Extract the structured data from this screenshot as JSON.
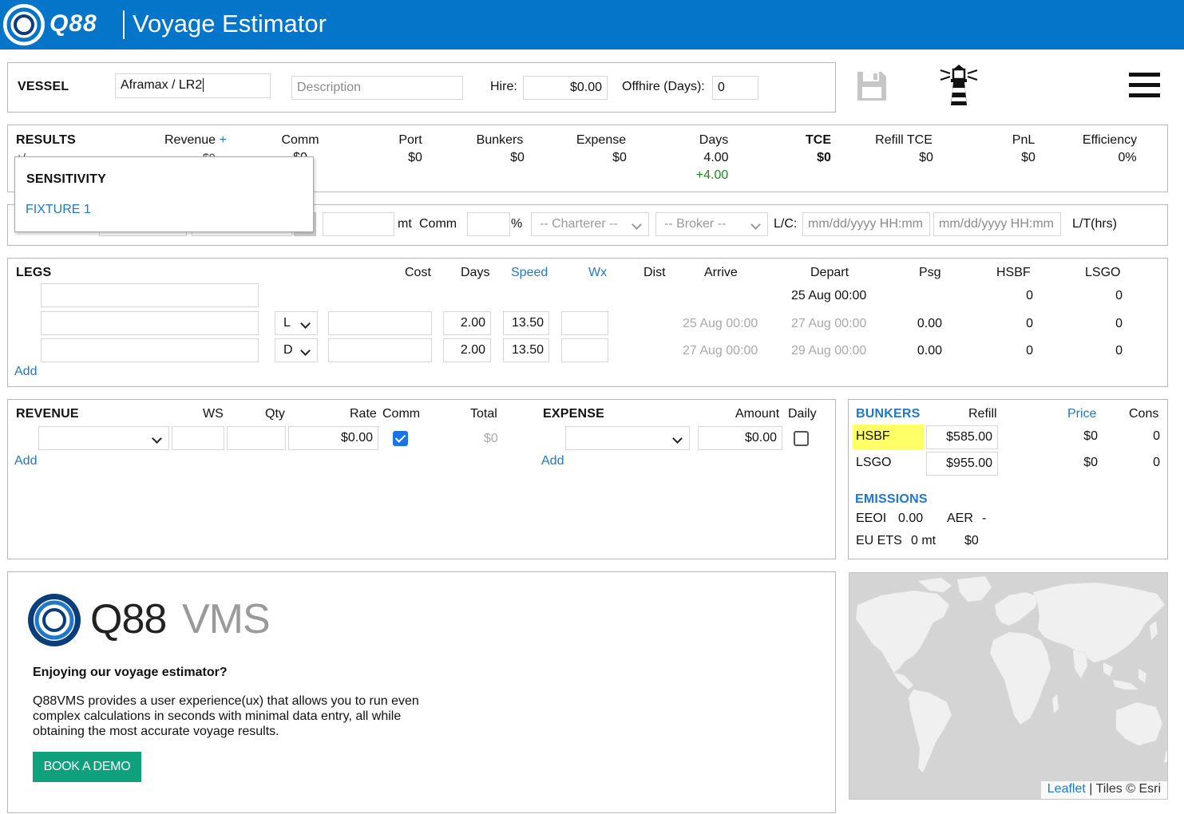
{
  "app": {
    "brand": "Q88",
    "title": "Voyage Estimator"
  },
  "colors": {
    "topbar": "#0575c9",
    "link": "#1f78c8",
    "positive": "#1a8a1a",
    "highlight": "#ffff66",
    "demo_button": "#0fa07e"
  },
  "vessel": {
    "label": "VESSEL",
    "name": "Aframax / LR2",
    "description_placeholder": "Description",
    "hire_label": "Hire:",
    "hire_value": "$0.00",
    "offhire_label": "Offhire (Days):",
    "offhire_value": "0"
  },
  "toolbar": {
    "save_icon": "floppy-disk-icon",
    "lighthouse_icon": "lighthouse-icon",
    "menu_icon": "hamburger-menu-icon"
  },
  "results": {
    "label": "RESULTS",
    "revenue_label": "Revenue",
    "revenue_plus": "+",
    "columns": [
      {
        "label": "Comm",
        "value": "$0"
      },
      {
        "label": "Port",
        "value": "$0"
      },
      {
        "label": "Bunkers",
        "value": "$0"
      },
      {
        "label": "Expense",
        "value": "$0"
      },
      {
        "label": "Days",
        "value": "4.00"
      },
      {
        "label": "TCE",
        "value": "$0"
      },
      {
        "label": "Refill TCE",
        "value": "$0"
      },
      {
        "label": "PnL",
        "value": "$0"
      },
      {
        "label": "Efficiency",
        "value": "0%"
      }
    ],
    "days_delta": "+4.00"
  },
  "sensitivity_popup": {
    "title": "SENSITIVITY",
    "item": "FIXTURE 1"
  },
  "cargo_row": {
    "qty_unit": "mt",
    "comm_label": "Comm",
    "comm_unit": "%",
    "charterer_placeholder": "-- Charterer --",
    "broker_placeholder": "-- Broker --",
    "lc_label": "L/C:",
    "lc_from_placeholder": "mm/dd/yyyy HH:mm",
    "lc_to_placeholder": "mm/dd/yyyy HH:mm",
    "lt_label": "L/T(hrs)"
  },
  "legs": {
    "label": "LEGS",
    "headers": {
      "cost": "Cost",
      "days": "Days",
      "speed": "Speed",
      "wx": "Wx",
      "dist": "Dist",
      "arrive": "Arrive",
      "depart": "Depart",
      "psg": "Psg",
      "hsbf": "HSBF",
      "lsgo": "LSGO"
    },
    "first_row": {
      "depart": "25 Aug 00:00",
      "hsbf": "0",
      "lsgo": "0"
    },
    "rows": [
      {
        "type": "L",
        "days": "2.00",
        "speed": "13.50",
        "arrive": "25 Aug 00:00",
        "depart": "27 Aug 00:00",
        "psg": "0.00",
        "hsbf": "0",
        "lsgo": "0"
      },
      {
        "type": "D",
        "days": "2.00",
        "speed": "13.50",
        "arrive": "27 Aug 00:00",
        "depart": "29 Aug 00:00",
        "psg": "0.00",
        "hsbf": "0",
        "lsgo": "0"
      }
    ],
    "add_label": "Add"
  },
  "revenue": {
    "label": "REVENUE",
    "headers": {
      "ws": "WS",
      "qty": "Qty",
      "rate": "Rate",
      "comm": "Comm",
      "total": "Total"
    },
    "rate_value": "$0.00",
    "comm_checked": true,
    "total_value": "$0",
    "add_label": "Add"
  },
  "expense": {
    "label": "EXPENSE",
    "headers": {
      "amount": "Amount",
      "daily": "Daily"
    },
    "amount_value": "$0.00",
    "daily_checked": false,
    "add_label": "Add"
  },
  "bunkers": {
    "label": "BUNKERS",
    "headers": {
      "refill": "Refill",
      "price": "Price",
      "cons": "Cons"
    },
    "rows": [
      {
        "name": "HSBF",
        "refill": "$585.00",
        "price": "$0",
        "cons": "0"
      },
      {
        "name": "LSGO",
        "refill": "$955.00",
        "price": "$0",
        "cons": "0"
      }
    ]
  },
  "emissions": {
    "label": "EMISSIONS",
    "eeoi_label": "EEOI",
    "eeoi_value": "0.00",
    "aer_label": "AER",
    "aer_value": "-",
    "euets_label": "EU ETS",
    "euets_qty": "0 mt",
    "euets_cost": "$0"
  },
  "promo": {
    "logo_q88": "Q88",
    "logo_vms": "VMS",
    "heading": "Enjoying our voyage estimator?",
    "body": "Q88VMS provides a user experience(ux) that allows you to run even complex calculations in seconds with minimal data entry, all while obtaining the most accurate voyage results.",
    "button": "BOOK A DEMO"
  },
  "map": {
    "attribution_link": "Leaflet",
    "attribution_text": "| Tiles © Esri"
  }
}
